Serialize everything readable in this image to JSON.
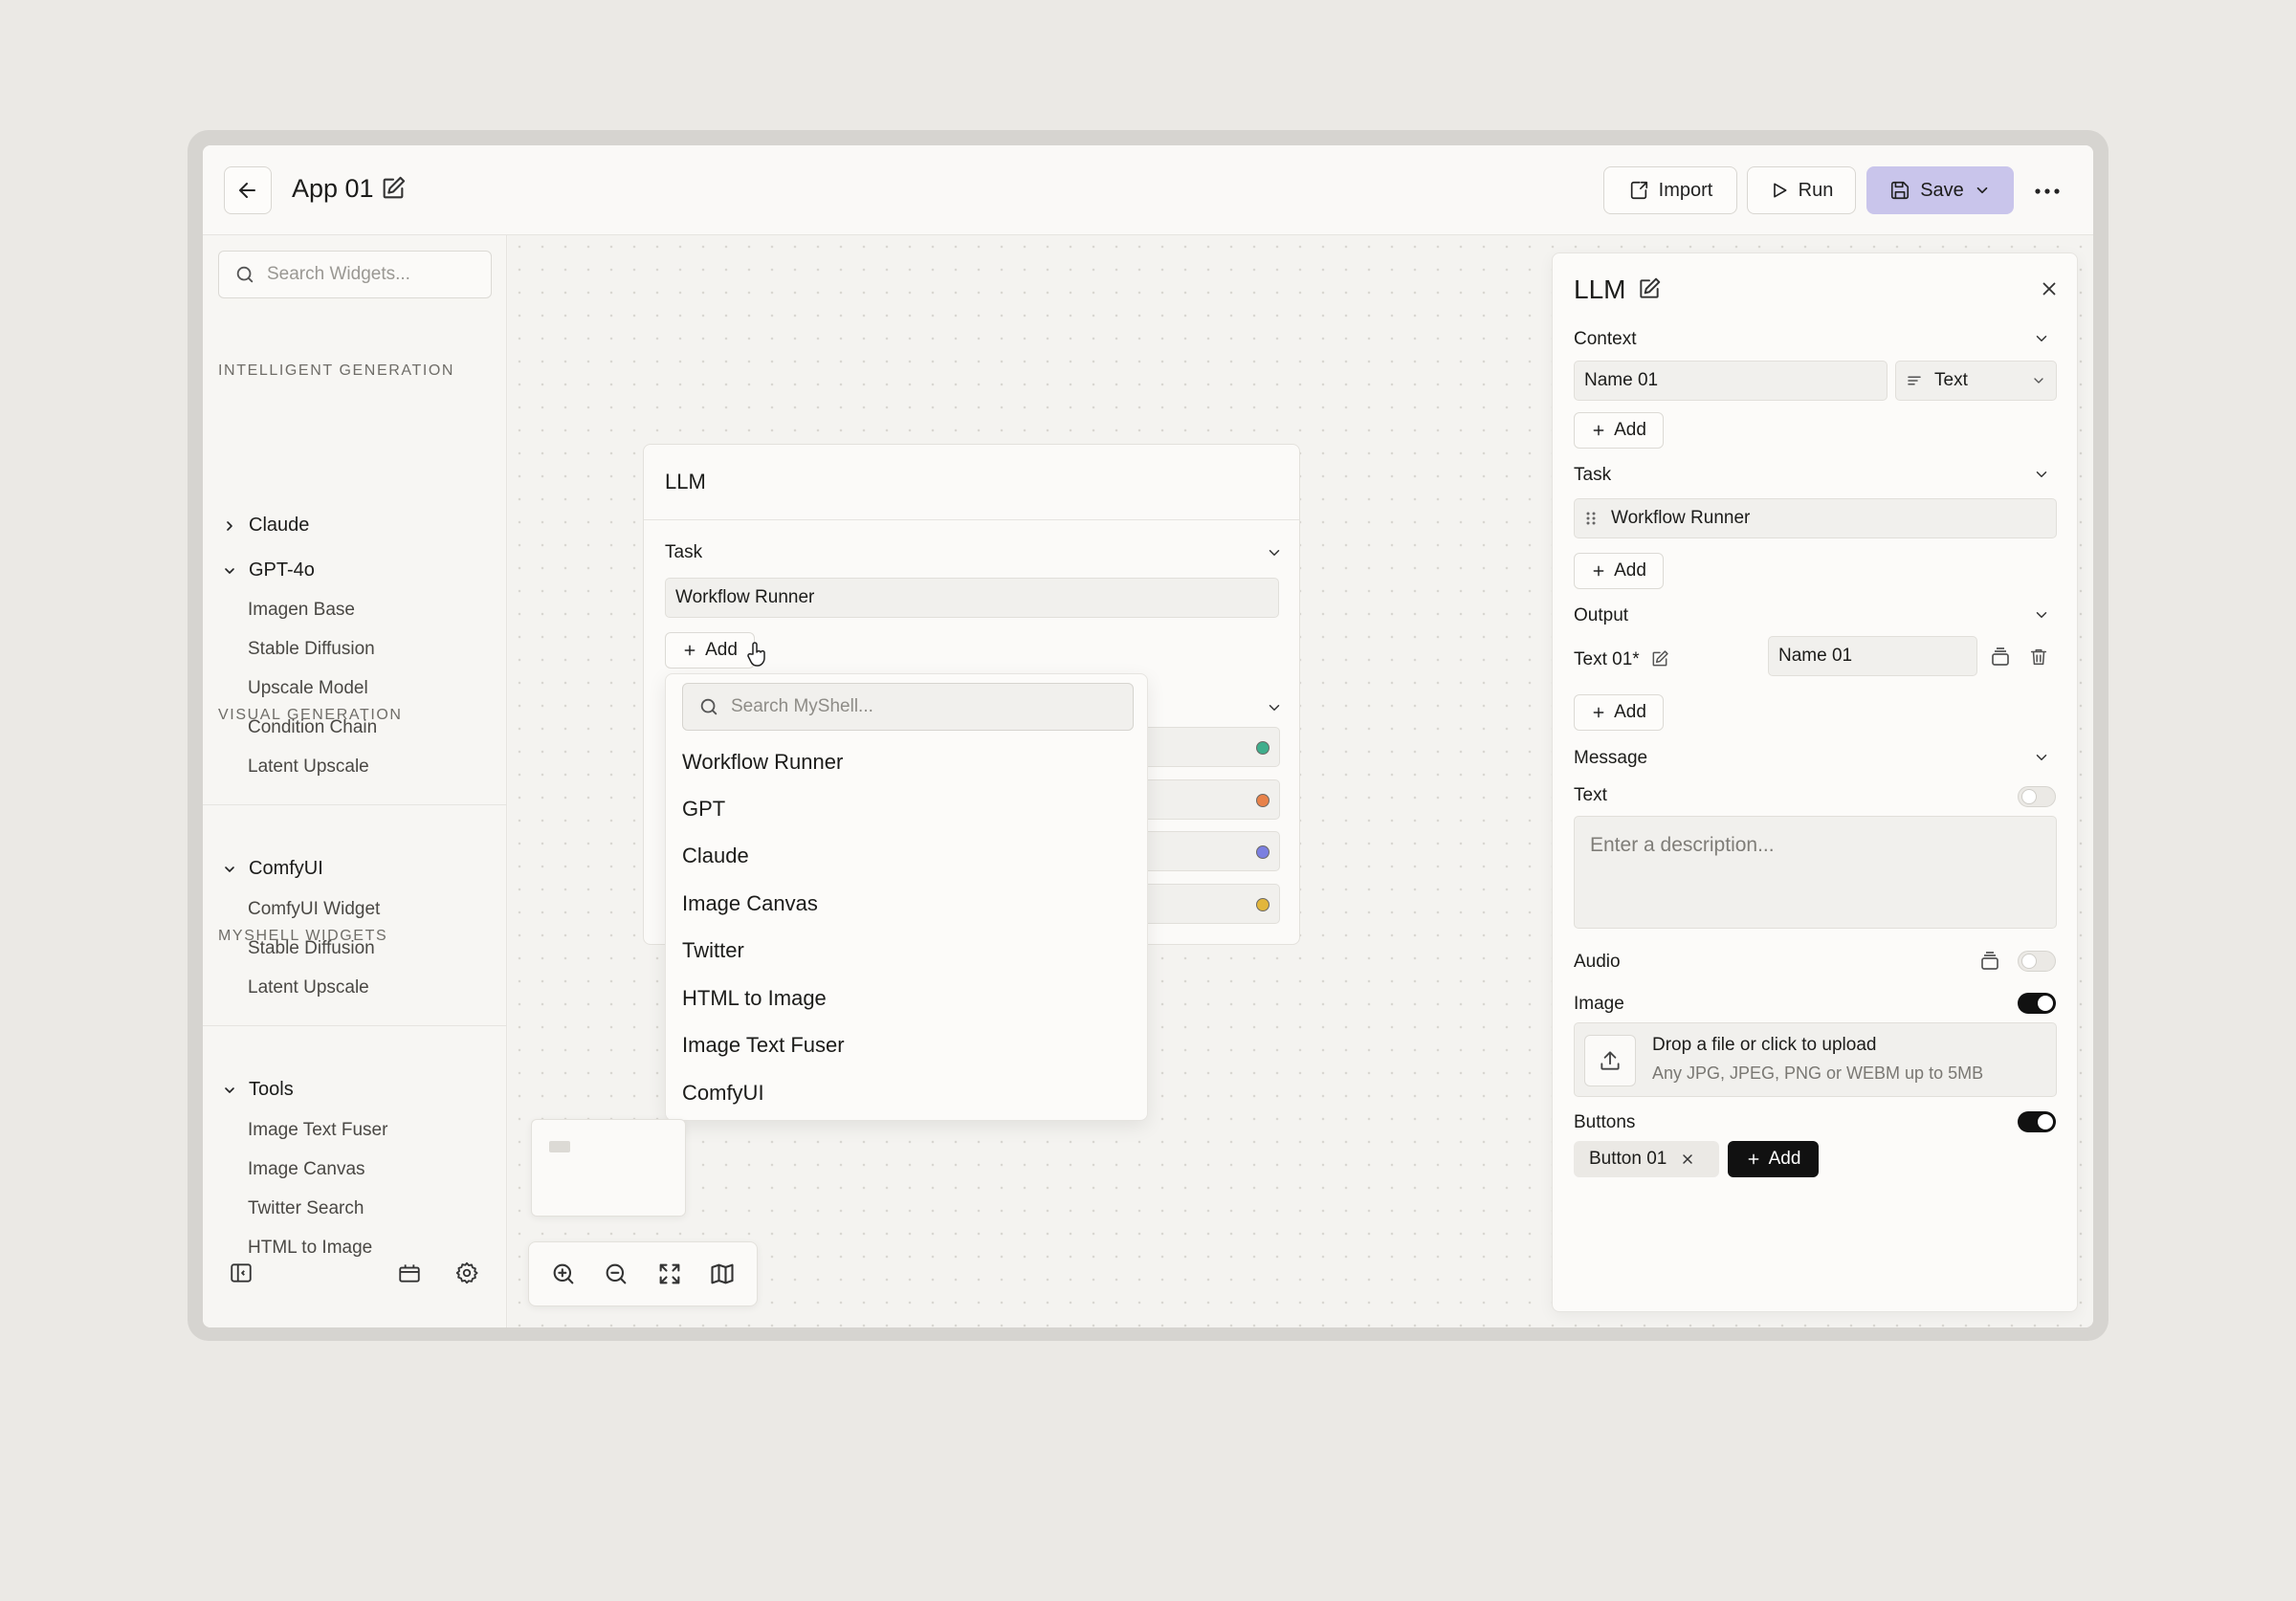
{
  "header": {
    "app_title": "App 01",
    "import_label": "Import",
    "run_label": "Run",
    "save_label": "Save"
  },
  "sidebar": {
    "search_placeholder": "Search Widgets...",
    "sections": [
      {
        "label": "INTELLIGENT GENERATION",
        "groups": [
          {
            "label": "Claude",
            "expanded": false,
            "items": []
          },
          {
            "label": "GPT-4o",
            "expanded": true,
            "items": [
              "Imagen Base",
              "Stable Diffusion",
              "Upscale Model",
              "Condition Chain",
              "Latent Upscale"
            ]
          }
        ]
      },
      {
        "label": "VISUAL GENERATION",
        "groups": [
          {
            "label": "ComfyUI",
            "expanded": true,
            "items": [
              "ComfyUI Widget",
              "Stable Diffusion",
              "Latent Upscale"
            ]
          }
        ]
      },
      {
        "label": "MYSHELL WIDGETS",
        "groups": [
          {
            "label": "Tools",
            "expanded": true,
            "items": [
              "Image Text Fuser",
              "Image Canvas",
              "Twitter Search",
              "HTML to Image"
            ]
          }
        ]
      }
    ]
  },
  "node": {
    "title": "LLM",
    "task_label": "Task",
    "task_value": "Workflow Runner",
    "add_label": "Add",
    "port_colors": [
      "#3fae8c",
      "#e8824a",
      "#7b7fe0",
      "#e2b63c"
    ]
  },
  "dropdown": {
    "search_placeholder": "Search MyShell...",
    "items": [
      "Workflow Runner",
      "GPT",
      "Claude",
      "Image Canvas",
      "Twitter",
      "HTML to Image",
      "Image Text Fuser",
      "ComfyUI"
    ]
  },
  "panel": {
    "title": "LLM",
    "context_label": "Context",
    "context_name": "Name 01",
    "context_type": "Text",
    "add_label": "Add",
    "task_label": "Task",
    "task_value": "Workflow Runner",
    "output_label": "Output",
    "output_name": "Text 01*",
    "output_value": "Name 01",
    "message_label": "Message",
    "text_label": "Text",
    "text_toggle": false,
    "description_placeholder": "Enter a description...",
    "audio_label": "Audio",
    "audio_toggle": false,
    "image_label": "Image",
    "image_toggle": true,
    "upload_title": "Drop a file or click to upload",
    "upload_subtitle": "Any JPG,  JPEG, PNG or WEBM up to 5MB",
    "buttons_label": "Buttons",
    "buttons_toggle": true,
    "button_chip": "Button 01"
  }
}
